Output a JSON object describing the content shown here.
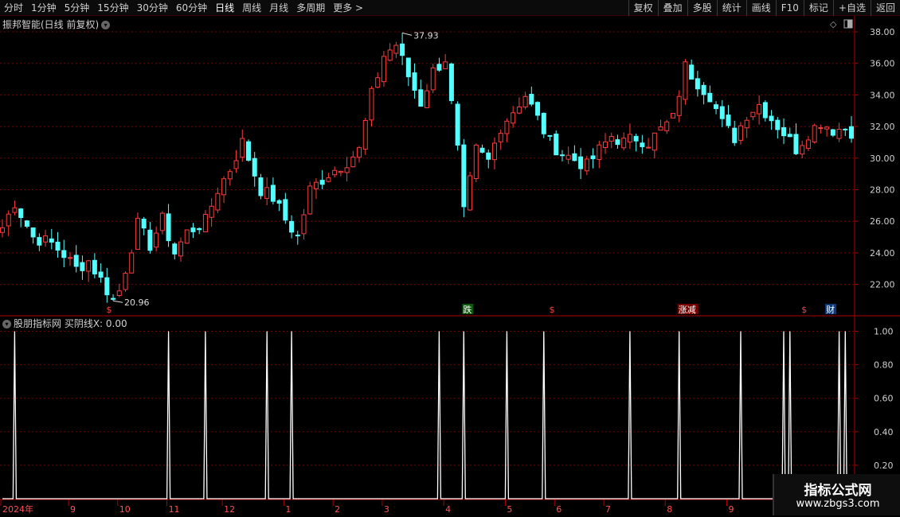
{
  "toolbar": {
    "periods": [
      {
        "label": "分时",
        "active": false
      },
      {
        "label": "1分钟",
        "active": false
      },
      {
        "label": "5分钟",
        "active": false
      },
      {
        "label": "15分钟",
        "active": false
      },
      {
        "label": "30分钟",
        "active": false
      },
      {
        "label": "60分钟",
        "active": false
      },
      {
        "label": "日线",
        "active": true
      },
      {
        "label": "周线",
        "active": false
      },
      {
        "label": "月线",
        "active": false
      },
      {
        "label": "多周期",
        "active": false
      },
      {
        "label": "更多 >",
        "active": false
      }
    ],
    "right": [
      "复权",
      "叠加",
      "多股",
      "统计",
      "画线",
      "F10",
      "标记",
      "+自选",
      "返回"
    ]
  },
  "stock": {
    "title": "振邦智能(日线 前复权)",
    "max_label": "37.93",
    "min_label": "20.96"
  },
  "indicator": {
    "title": "股朋指标网  买阴线X: 0.00"
  },
  "watermark": {
    "line1": "指标公式网",
    "line2": "www.zbgs3.com"
  },
  "colors": {
    "up": "#ff3b3b",
    "down": "#54ffff",
    "grid": "#7a0000",
    "axis": "#b00000",
    "line": "#ffffff",
    "axis_text": "#d0d0d0"
  },
  "chart_data": [
    {
      "type": "candlestick",
      "price_ticks": [
        "38.00",
        "36.00",
        "34.00",
        "32.00",
        "30.00",
        "28.00",
        "26.00",
        "24.00",
        "22.00"
      ],
      "ylim": [
        20.0,
        39.2
      ],
      "date_ticks": [
        {
          "label": "2024年",
          "i": 0
        },
        {
          "label": "9",
          "i": 11
        },
        {
          "label": "10",
          "i": 19
        },
        {
          "label": "11",
          "i": 27
        },
        {
          "label": "12",
          "i": 36
        },
        {
          "label": "1",
          "i": 46
        },
        {
          "label": "2",
          "i": 54
        },
        {
          "label": "3",
          "i": 62
        },
        {
          "label": "4",
          "i": 72
        },
        {
          "label": "5",
          "i": 82
        },
        {
          "label": "6",
          "i": 90
        },
        {
          "label": "7",
          "i": 98
        },
        {
          "label": "8",
          "i": 108
        },
        {
          "label": "9",
          "i": 118
        }
      ],
      "anchors": [
        [
          0,
          25.6
        ],
        [
          2,
          27.2
        ],
        [
          5,
          25.0
        ],
        [
          8,
          24.6
        ],
        [
          10,
          23.9
        ],
        [
          12,
          23.0
        ],
        [
          14,
          23.5
        ],
        [
          16,
          22.3
        ],
        [
          18,
          21.0
        ],
        [
          19,
          21.6
        ],
        [
          22,
          25.8
        ],
        [
          24,
          24.5
        ],
        [
          26,
          26.1
        ],
        [
          28,
          24.0
        ],
        [
          30,
          25.3
        ],
        [
          33,
          26.0
        ],
        [
          35,
          28.0
        ],
        [
          37,
          29.3
        ],
        [
          39,
          31.0
        ],
        [
          40,
          30.0
        ],
        [
          42,
          28.0
        ],
        [
          44,
          27.5
        ],
        [
          46,
          26.1
        ],
        [
          48,
          25.0
        ],
        [
          50,
          28.0
        ],
        [
          53,
          29.0
        ],
        [
          56,
          29.8
        ],
        [
          58,
          30.5
        ],
        [
          60,
          34.0
        ],
        [
          62,
          36.5
        ],
        [
          64,
          37.2
        ],
        [
          66,
          35.2
        ],
        [
          68,
          33.5
        ],
        [
          70,
          35.5
        ],
        [
          72,
          36.3
        ],
        [
          74,
          30.5
        ],
        [
          75,
          26.5
        ],
        [
          77,
          30.5
        ],
        [
          79,
          29.8
        ],
        [
          81,
          32.0
        ],
        [
          83,
          33.0
        ],
        [
          85,
          34.0
        ],
        [
          87,
          32.5
        ],
        [
          89,
          31.0
        ],
        [
          91,
          30.3
        ],
        [
          93,
          29.9
        ],
        [
          95,
          29.5
        ],
        [
          97,
          30.5
        ],
        [
          99,
          31.4
        ],
        [
          101,
          31.0
        ],
        [
          103,
          31.3
        ],
        [
          105,
          31.0
        ],
        [
          107,
          31.8
        ],
        [
          109,
          32.5
        ],
        [
          111,
          35.8
        ],
        [
          113,
          34.8
        ],
        [
          115,
          34.0
        ],
        [
          117,
          32.2
        ],
        [
          119,
          31.3
        ],
        [
          121,
          32.8
        ],
        [
          123,
          33.4
        ],
        [
          125,
          32.5
        ],
        [
          127,
          31.6
        ],
        [
          129,
          30.6
        ],
        [
          131,
          31.6
        ],
        [
          133,
          32.3
        ],
        [
          135,
          31.8
        ],
        [
          137,
          31.9
        ],
        [
          138,
          31.7
        ]
      ],
      "counts": {
        "candles": 139
      },
      "markers": [
        {
          "label": "$",
          "i": 17,
          "color": "#ff4040"
        },
        {
          "label": "跌",
          "i": 75,
          "color": "#ffffff",
          "bg": "#0a5a0a"
        },
        {
          "label": "$",
          "i": 89,
          "color": "#ff4040"
        },
        {
          "label": "涨减",
          "i": 110,
          "color": "#ffffff",
          "bg": "#7a0000"
        },
        {
          "label": "$",
          "i": 130,
          "color": "#ff4040"
        },
        {
          "label": "财",
          "i": 134,
          "color": "#ffffff",
          "bg": "#0a3a7a"
        }
      ]
    },
    {
      "type": "line",
      "name": "买阴线X",
      "y_ticks": [
        "1.00",
        "0.80",
        "0.60",
        "0.40",
        "0.20"
      ],
      "ylim": [
        0,
        1.05
      ],
      "spikes": [
        2,
        27,
        33,
        43,
        47,
        71,
        75,
        82,
        88,
        102,
        110,
        120,
        127,
        128,
        136,
        137
      ]
    }
  ]
}
